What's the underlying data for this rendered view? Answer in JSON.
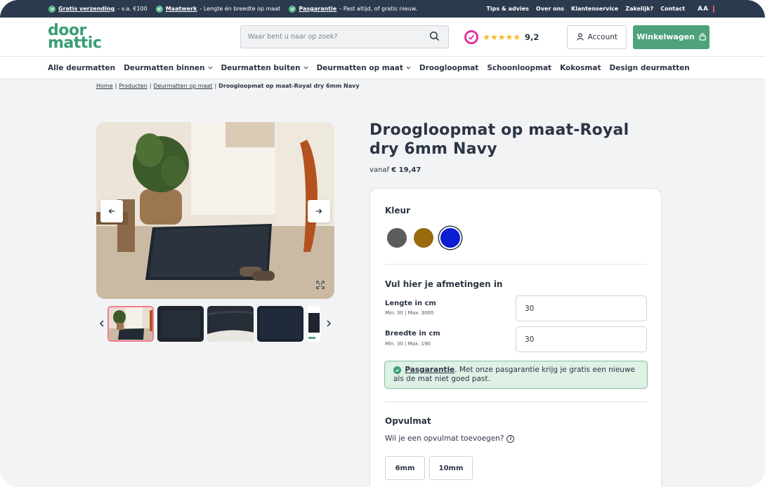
{
  "topbar": {
    "usps": [
      {
        "bold": "Gratis verzending",
        "text": "- v.a. €100"
      },
      {
        "bold": "Maatwerk",
        "text": "- Lengte én breedte op maat"
      },
      {
        "bold": "Pasgarantie",
        "text": "- Past altijd, of gratis nieuw."
      }
    ],
    "links": [
      "Tips & advies",
      "Over ons",
      "Klantenservice",
      "Zakelijk?",
      "Contact"
    ],
    "aa_label": "AA"
  },
  "header": {
    "logo_line1": "door",
    "logo_line2": "mattic",
    "search_placeholder": "Waar bent u naar op zoek?",
    "stars": "★★★★★",
    "rating": "9,2",
    "account_label": "Account",
    "cart_label": "Winkelwagen"
  },
  "nav": [
    {
      "label": "Alle deurmatten",
      "dropdown": false
    },
    {
      "label": "Deurmatten binnen",
      "dropdown": true
    },
    {
      "label": "Deurmatten buiten",
      "dropdown": true
    },
    {
      "label": "Deurmatten op maat",
      "dropdown": true
    },
    {
      "label": "Droogloopmat",
      "dropdown": false
    },
    {
      "label": "Schoonloopmat",
      "dropdown": false
    },
    {
      "label": "Kokosmat",
      "dropdown": false
    },
    {
      "label": "Design deurmatten",
      "dropdown": false
    }
  ],
  "breadcrumb": {
    "items": [
      "Home",
      "Producten",
      "Deurmatten op maat"
    ],
    "separator": "|",
    "current": "Droogloopmat op maat-Royal dry 6mm Navy"
  },
  "product": {
    "title": "Droogloopmat op maat-Royal dry 6mm Navy",
    "price_prefix": "vanaf",
    "price": "€ 19,47"
  },
  "config": {
    "color_title": "Kleur",
    "colors": [
      "#5c5c5c",
      "#9a6a0f",
      "#0a1dd0"
    ],
    "selected_color_index": 2,
    "dimensions_title": "Vul hier je afmetingen in",
    "length_label": "Lengte in cm",
    "length_hint": "Min. 30 | Max. 3000",
    "length_value": "30",
    "width_label": "Breedte in cm",
    "width_hint": "Min. 30 | Max. 190",
    "width_value": "30",
    "guarantee_link": "Pasgarantie",
    "guarantee_text": ". Met onze pasgarantie krijg je gratis een nieuwe als de mat niet goed past.",
    "underlay_title": "Opvulmat",
    "underlay_question": "Wil je een opvulmat toevoegen?",
    "underlay_options": [
      "6mm",
      "10mm"
    ]
  },
  "colors": {
    "topbar": "#2c3a4f",
    "brand_green": "#4ea27c",
    "text": "#2b3544",
    "star": "#f5b921"
  }
}
